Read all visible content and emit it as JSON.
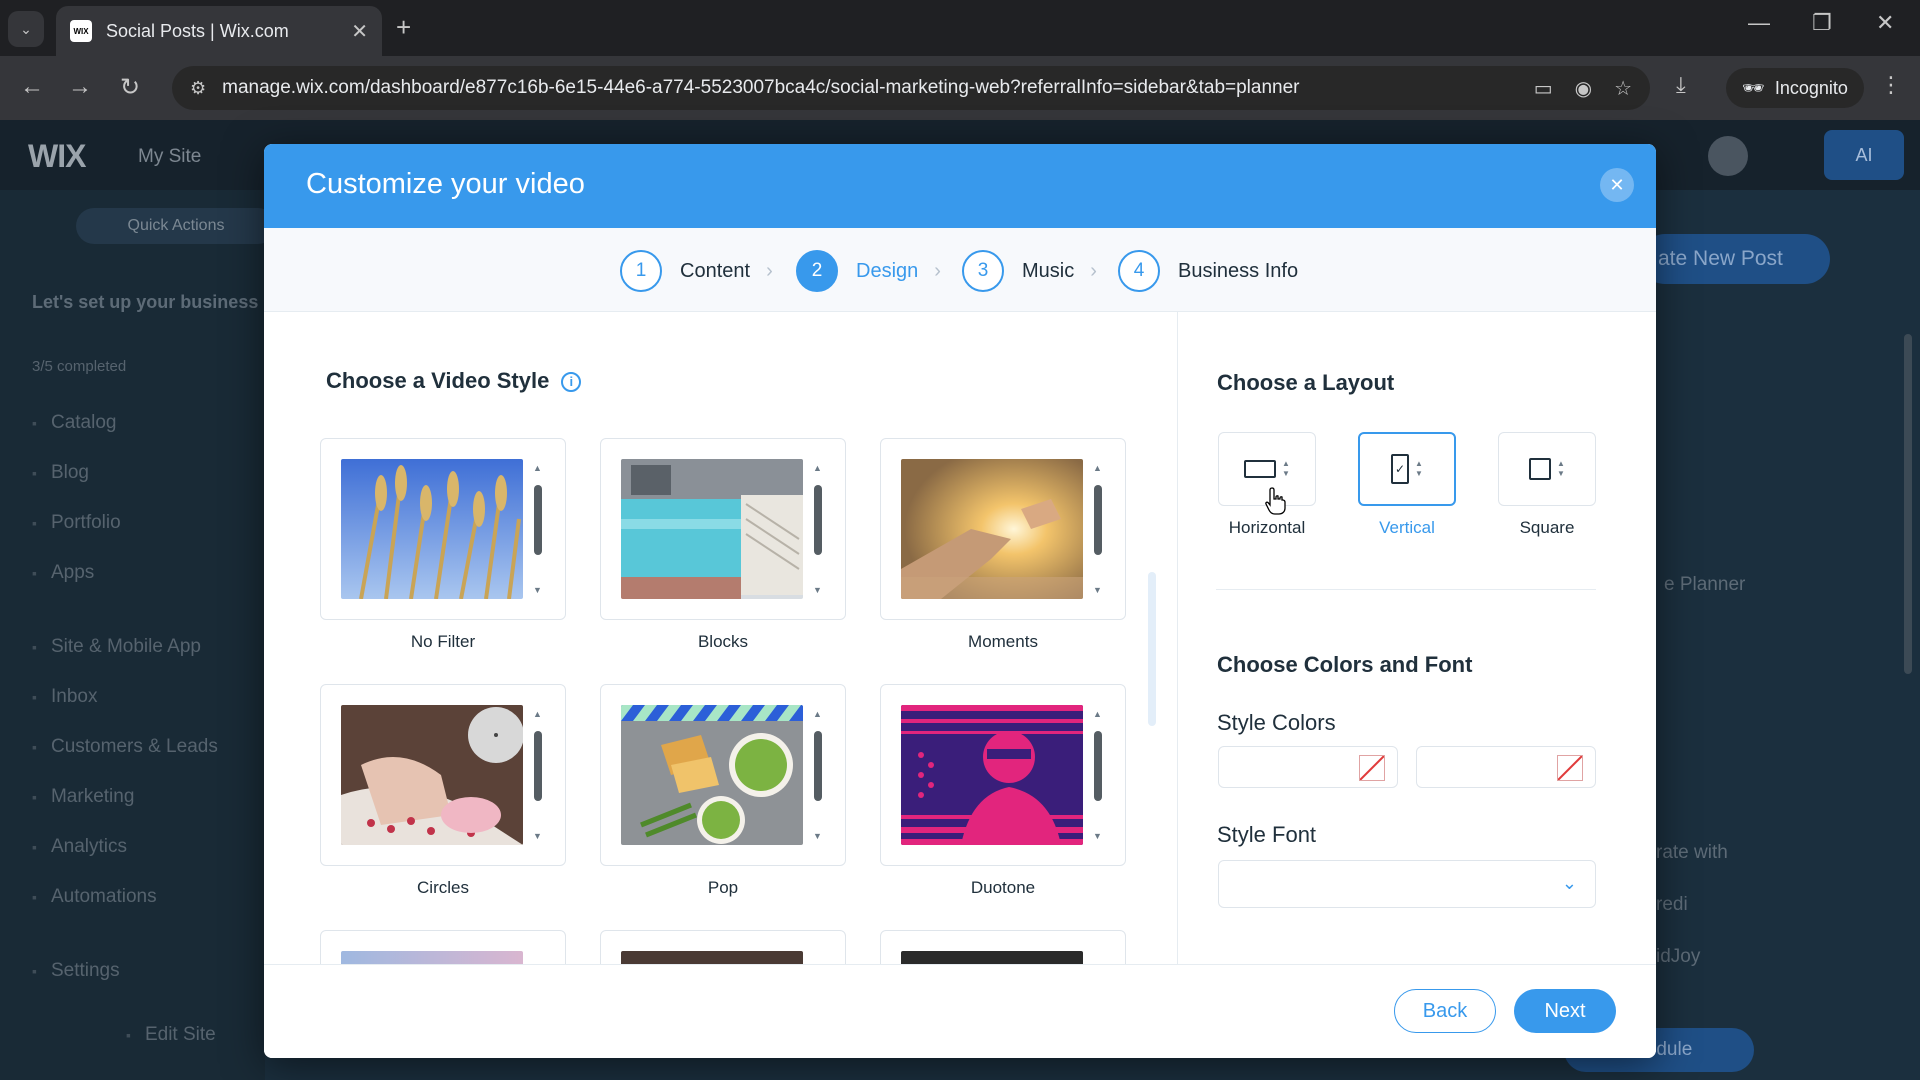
{
  "browser": {
    "tab_title": "Social Posts | Wix.com",
    "favicon_text": "WIX",
    "url": "manage.wix.com/dashboard/e877c16b-6e15-44e6-a774-5523007bca4c/social-marketing-web?referralInfo=sidebar&tab=planner",
    "incognito_label": "Incognito"
  },
  "background": {
    "logo": "WIX",
    "site_name": "My Site",
    "ai_label": "AI",
    "quick_actions": "Quick Actions",
    "setup_title": "Let's set up your business",
    "completed": "3/5 completed",
    "sidebar_items": [
      "Catalog",
      "Blog",
      "Portfolio",
      "Apps",
      "Site & Mobile App",
      "Inbox",
      "Customers & Leads",
      "Marketing",
      "Analytics",
      "Automations",
      "Settings"
    ],
    "edit_site": "Edit Site",
    "create_post": "ate New Post",
    "planner": "e Planner",
    "side_text": [
      "rate with",
      "redi",
      "idJoy"
    ],
    "schedule": "chedule"
  },
  "modal": {
    "title": "Customize your video",
    "steps": [
      {
        "num": "1",
        "label": "Content"
      },
      {
        "num": "2",
        "label": "Design"
      },
      {
        "num": "3",
        "label": "Music"
      },
      {
        "num": "4",
        "label": "Business Info"
      }
    ],
    "active_step": 2,
    "video_style_title": "Choose a Video Style",
    "info_glyph": "i",
    "styles": [
      "No Filter",
      "Blocks",
      "Moments",
      "Circles",
      "Pop",
      "Duotone"
    ],
    "layout_title": "Choose a Layout",
    "layouts": [
      "Horizontal",
      "Vertical",
      "Square"
    ],
    "selected_layout": "Vertical",
    "colors_font_title": "Choose Colors and Font",
    "style_colors_label": "Style Colors",
    "style_font_label": "Style Font",
    "style_font_value": "",
    "back_label": "Back",
    "next_label": "Next"
  },
  "colors": {
    "accent": "#3899ec",
    "header": "#3899ec",
    "text": "#20303c"
  }
}
